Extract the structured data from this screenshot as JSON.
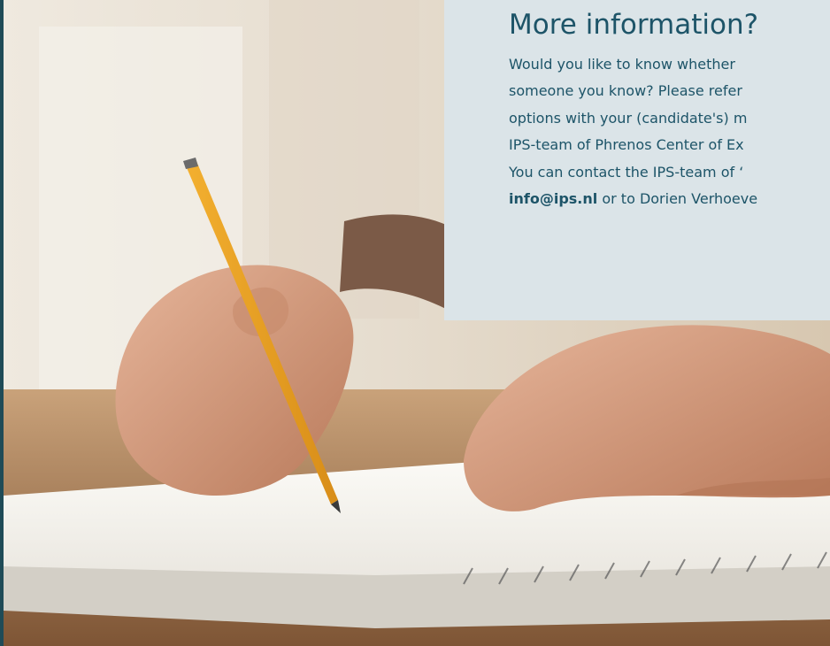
{
  "info": {
    "title": "More information?",
    "lines": [
      "Would you like to know whether",
      "someone you know? Please refer",
      "options with your (candidate's) m",
      "IPS-team of Phrenos Center of Ex",
      "You can contact the IPS-team of ‘"
    ],
    "email": "info@ips.nl",
    "last_line_suffix": " or to Dorien Verhoeve"
  },
  "photo": {
    "description_icon": "hand-writing-image"
  },
  "colors": {
    "card_bg": "#dbe4e8",
    "text": "#1d5468",
    "page_bg": "#1f4b57"
  }
}
